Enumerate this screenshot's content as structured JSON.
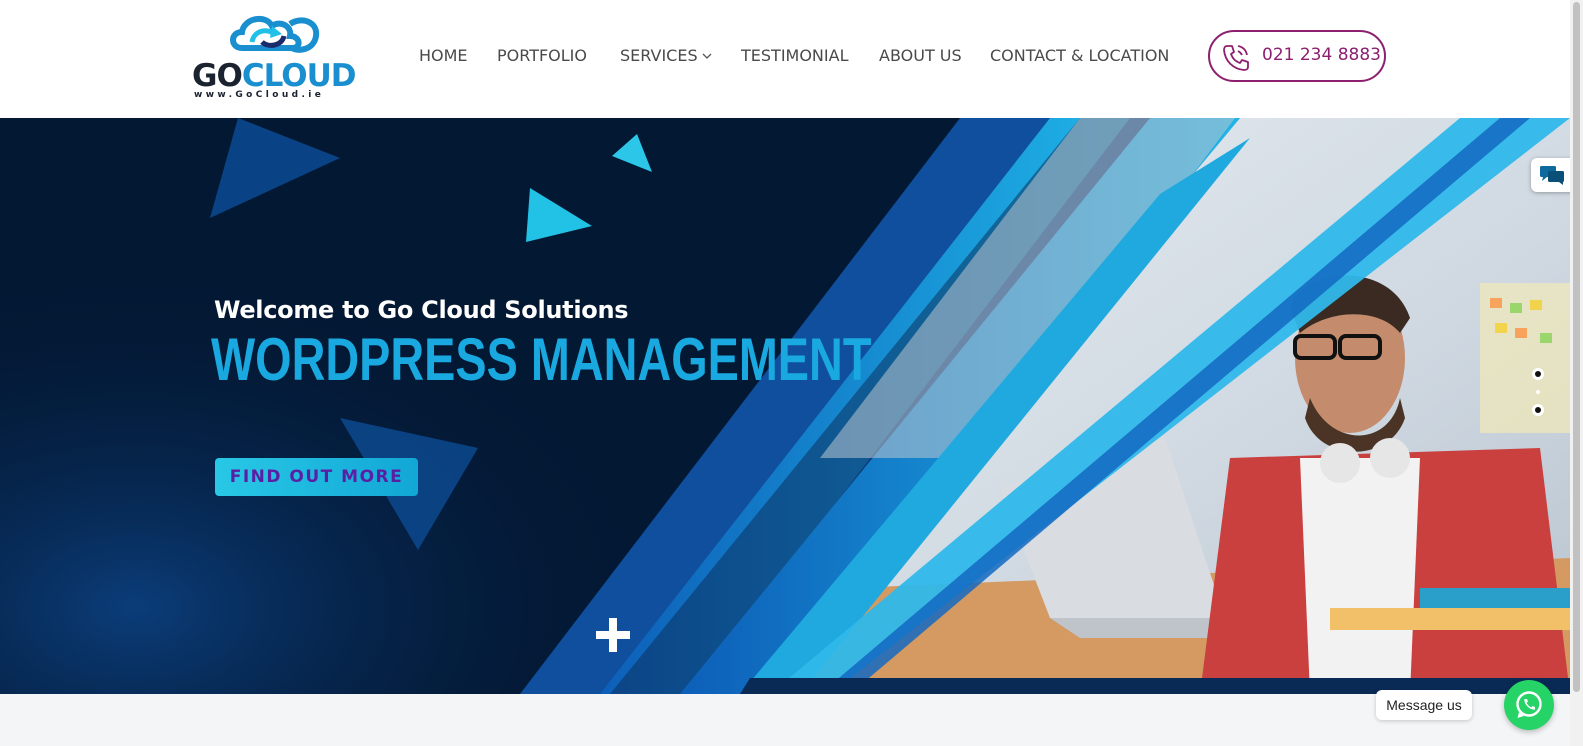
{
  "logo": {
    "text_go": "GO",
    "text_cloud": "CLOUD",
    "url": "www.GoCloud.ie",
    "icon": "cloud-sync-logo"
  },
  "nav": {
    "items": [
      {
        "label": "HOME"
      },
      {
        "label": "PORTFOLIO"
      },
      {
        "label": "SERVICES",
        "icon": "chevron-down-icon"
      },
      {
        "label": "TESTIMONIAL"
      },
      {
        "label": "ABOUT US"
      },
      {
        "label": "CONTACT & LOCATION"
      }
    ],
    "phone": {
      "number": "021 234 8883",
      "icon": "phone-icon",
      "color": "#8c1f6f"
    }
  },
  "hero": {
    "welcome": "Welcome to Go Cloud Solutions",
    "headline": "WORDPRESS MANAGEMENT",
    "cta_label": "FIND OUT MORE",
    "accent": "#19a9e0",
    "background": "#031833",
    "slider_dots": 3,
    "plus_icon": "plus-icon"
  },
  "widgets": {
    "chat_tab_icon": "chat-bubbles-icon",
    "message_label": "Message us",
    "whatsapp_icon": "whatsapp-icon",
    "whatsapp_color": "#25d366"
  }
}
